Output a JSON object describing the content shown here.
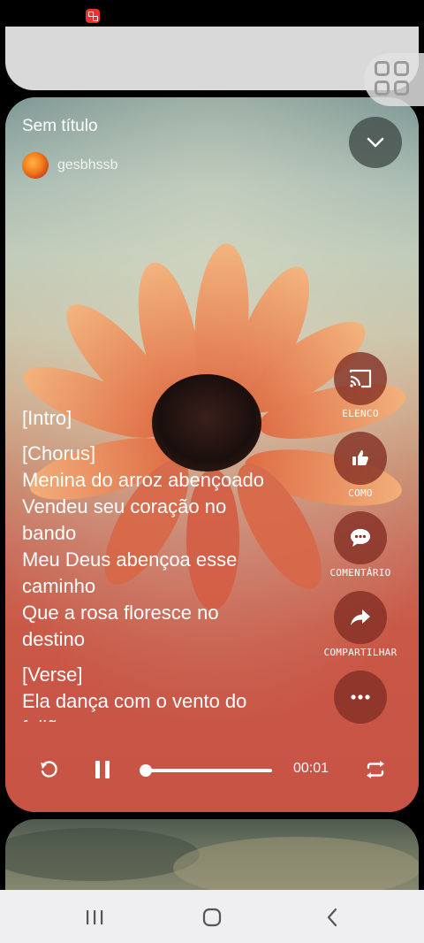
{
  "status_bar": {
    "app_icon": "app-notification-icon"
  },
  "player": {
    "title": "Sem título",
    "author": "gesbhssb",
    "lyrics": {
      "intro": "[Intro]",
      "chorus_tag": "[Chorus]",
      "line1": "Menina do arroz abençoado",
      "line2": "Vendeu seu coração no",
      "line3": "bando",
      "line4": "Meu Deus abençoa esse",
      "line5": "caminho",
      "line6": "Que a rosa floresce no",
      "line7": "destino",
      "verse_tag": "[Verse]",
      "line8": "Ela dança com o vento do",
      "line9": "feijão"
    },
    "actions": {
      "cast": "ELENCO",
      "like": "COMO",
      "comment": "COMENTÁRIO",
      "share": "COMPARTILHAR"
    },
    "time": "00:01",
    "progress_fraction": 0.02
  },
  "colors": {
    "accent_action": "#8a2f24",
    "card_bg_bottom": "#c85445"
  }
}
